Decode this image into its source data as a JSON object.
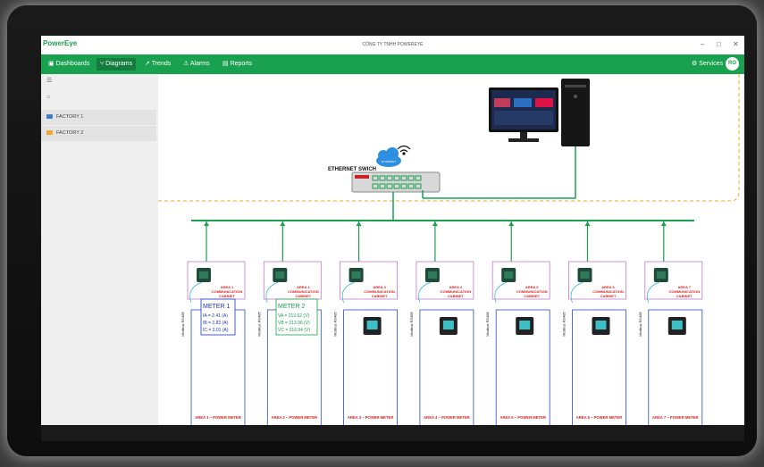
{
  "app": {
    "logo_text": "PowerEye",
    "title": "CÔNG TY TNHH POWEREYE",
    "minimize": "–",
    "maximize": "□",
    "close": "✕"
  },
  "nav": {
    "items": [
      {
        "label": "Dashboards",
        "icon": "dashboard-icon"
      },
      {
        "label": "Diagrams",
        "icon": "diagram-icon",
        "active": true
      },
      {
        "label": "Trends",
        "icon": "trend-icon"
      },
      {
        "label": "Alarms",
        "icon": "alarm-icon"
      },
      {
        "label": "Reports",
        "icon": "report-icon"
      }
    ],
    "services": "Services",
    "avatar": "RO"
  },
  "sidebar": {
    "menu_icon": "menu-icon",
    "home_icon": "home-icon",
    "items": [
      {
        "label": "FACTORY 1",
        "color": "#3b7fc4"
      },
      {
        "label": "FACTORY 2",
        "color": "#f0a830"
      }
    ]
  },
  "diagram": {
    "switch_label": "ETHERNET SWICH",
    "cloud_label": "ETHERNET",
    "modbus_label": "Modbus RS485",
    "areas": [
      {
        "cabinet": "AREA 1",
        "cabinet_sub": "COMMUNICATION",
        "cabinet_sub2": "CABINET",
        "meter_label": "AREA 1 – POWER METER"
      },
      {
        "cabinet": "AREA 2",
        "cabinet_sub": "COMMUNICATION",
        "cabinet_sub2": "CABINET",
        "meter_label": "AREA 2 – POWER METER"
      },
      {
        "cabinet": "AREA 3",
        "cabinet_sub": "COMMUNICATION",
        "cabinet_sub2": "CABINET",
        "meter_label": "AREA 3 – POWER METER"
      },
      {
        "cabinet": "AREA 4",
        "cabinet_sub": "COMMUNICATION",
        "cabinet_sub2": "CABINET",
        "meter_label": "AREA 4 – POWER METER"
      },
      {
        "cabinet": "AREA 5",
        "cabinet_sub": "COMMUNICATION",
        "cabinet_sub2": "CABINET",
        "meter_label": "AREA 5 – POWER METER"
      },
      {
        "cabinet": "AREA 6",
        "cabinet_sub": "COMMUNICATION",
        "cabinet_sub2": "CABINET",
        "meter_label": "AREA 6 – POWER METER"
      },
      {
        "cabinet": "AREA 7",
        "cabinet_sub": "COMMUNICATION",
        "cabinet_sub2": "CABINET",
        "meter_label": "AREA 7 – POWER METER"
      }
    ],
    "meter1": {
      "title": "METER 1",
      "lines": [
        "IA = 2.41 (A)",
        "IB = 2.82 (A)",
        "IC = 2.01 (A)"
      ],
      "color": "#1a35c8"
    },
    "meter2": {
      "title": "METER 2",
      "lines": [
        "VA = 213.62 (V)",
        "VB = 213.96 (V)",
        "VC = 216.94 (V)"
      ],
      "color": "#1aa150"
    }
  },
  "colors": {
    "accent": "#1aa150",
    "bus": "#1aa150",
    "cabinet_border": "#c07ad0",
    "meter_border": "#2a4dc8",
    "area_text": "#e02020",
    "dashed": "#f0a830"
  }
}
